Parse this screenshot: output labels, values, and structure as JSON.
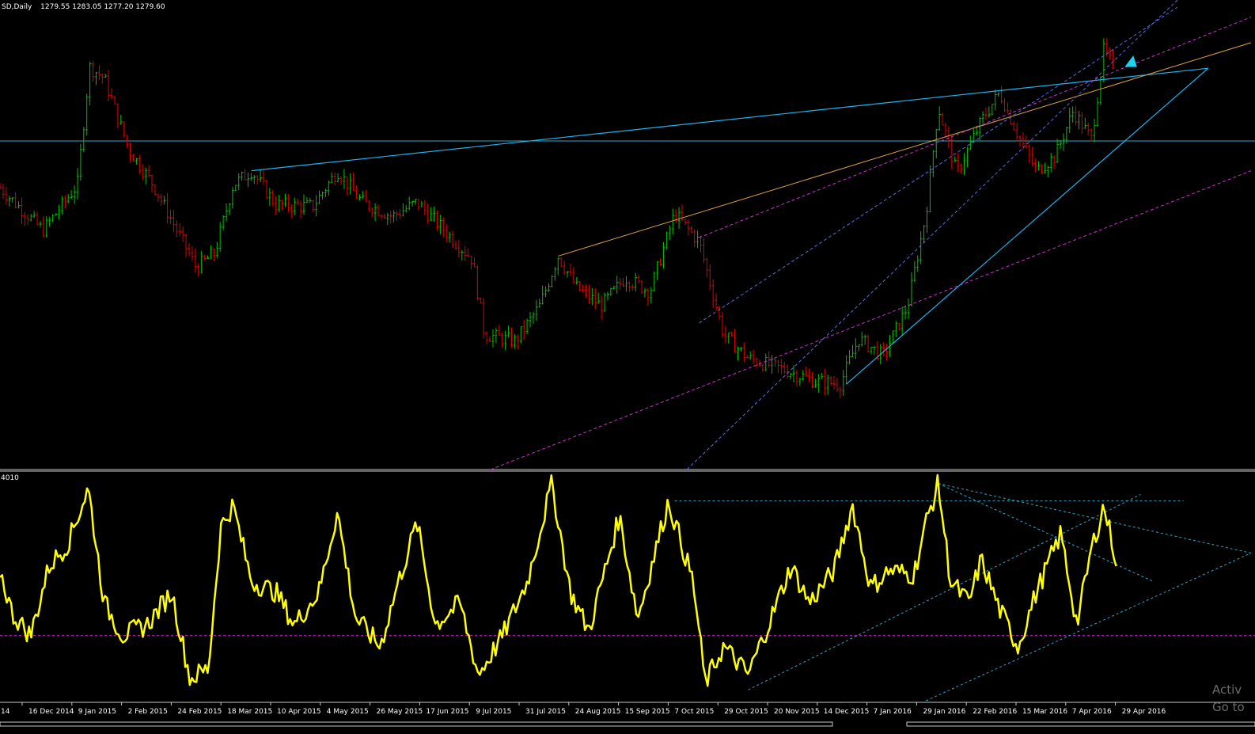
{
  "chart_data": {
    "type": "candlestick-with-oscillator",
    "header": {
      "symbol_timeframe": "SD,Daily",
      "ohlc": "1279.55 1283.05 1277.20 1279.60"
    },
    "oscillator_label": "4010",
    "x_tick_labels": [
      "14",
      "16 Dec 2014",
      "9 Jan 2015",
      "2 Feb 2015",
      "24 Feb 2015",
      "18 Mar 2015",
      "10 Apr 2015",
      "4 May 2015",
      "26 May 2015",
      "17 Jun 2015",
      "9 Jul 2015",
      "31 Jul 2015",
      "24 Aug 2015",
      "15 Sep 2015",
      "7 Oct 2015",
      "29 Oct 2015",
      "20 Nov 2015",
      "14 Dec 2015",
      "7 Jan 2016",
      "29 Jan 2016",
      "22 Feb 2016",
      "15 Mar 2016",
      "7 Apr 2016",
      "29 Apr 2016"
    ],
    "price_anchors": [
      {
        "t": 0,
        "p": 1198
      },
      {
        "t": 0.035,
        "p": 1168
      },
      {
        "t": 0.063,
        "p": 1200
      },
      {
        "t": 0.073,
        "p": 1283
      },
      {
        "t": 0.085,
        "p": 1275
      },
      {
        "t": 0.105,
        "p": 1225
      },
      {
        "t": 0.125,
        "p": 1200
      },
      {
        "t": 0.16,
        "p": 1142
      },
      {
        "t": 0.175,
        "p": 1152
      },
      {
        "t": 0.19,
        "p": 1200
      },
      {
        "t": 0.205,
        "p": 1210
      },
      {
        "t": 0.225,
        "p": 1186
      },
      {
        "t": 0.255,
        "p": 1185
      },
      {
        "t": 0.275,
        "p": 1210
      },
      {
        "t": 0.295,
        "p": 1188
      },
      {
        "t": 0.32,
        "p": 1178
      },
      {
        "t": 0.34,
        "p": 1188
      },
      {
        "t": 0.36,
        "p": 1170
      },
      {
        "t": 0.385,
        "p": 1148
      },
      {
        "t": 0.395,
        "p": 1095
      },
      {
        "t": 0.42,
        "p": 1090
      },
      {
        "t": 0.44,
        "p": 1115
      },
      {
        "t": 0.455,
        "p": 1150
      },
      {
        "t": 0.47,
        "p": 1128
      },
      {
        "t": 0.49,
        "p": 1115
      },
      {
        "t": 0.51,
        "p": 1135
      },
      {
        "t": 0.53,
        "p": 1125
      },
      {
        "t": 0.55,
        "p": 1180
      },
      {
        "t": 0.57,
        "p": 1160
      },
      {
        "t": 0.59,
        "p": 1095
      },
      {
        "t": 0.61,
        "p": 1078
      },
      {
        "t": 0.64,
        "p": 1070
      },
      {
        "t": 0.665,
        "p": 1062
      },
      {
        "t": 0.685,
        "p": 1060
      },
      {
        "t": 0.7,
        "p": 1092
      },
      {
        "t": 0.72,
        "p": 1080
      },
      {
        "t": 0.74,
        "p": 1115
      },
      {
        "t": 0.755,
        "p": 1180
      },
      {
        "t": 0.765,
        "p": 1255
      },
      {
        "t": 0.78,
        "p": 1208
      },
      {
        "t": 0.8,
        "p": 1245
      },
      {
        "t": 0.815,
        "p": 1265
      },
      {
        "t": 0.83,
        "p": 1235
      },
      {
        "t": 0.845,
        "p": 1210
      },
      {
        "t": 0.86,
        "p": 1220
      },
      {
        "t": 0.875,
        "p": 1252
      },
      {
        "t": 0.89,
        "p": 1232
      },
      {
        "t": 0.9,
        "p": 1295
      },
      {
        "t": 0.91,
        "p": 1279
      }
    ],
    "oscillator_anchors": [
      {
        "t": 0,
        "v": 60
      },
      {
        "t": 0.01,
        "v": 40
      },
      {
        "t": 0.025,
        "v": 30
      },
      {
        "t": 0.04,
        "v": 62
      },
      {
        "t": 0.055,
        "v": 72
      },
      {
        "t": 0.072,
        "v": 98
      },
      {
        "t": 0.085,
        "v": 45
      },
      {
        "t": 0.1,
        "v": 30
      },
      {
        "t": 0.12,
        "v": 35
      },
      {
        "t": 0.14,
        "v": 50
      },
      {
        "t": 0.155,
        "v": 10
      },
      {
        "t": 0.17,
        "v": 15
      },
      {
        "t": 0.18,
        "v": 80
      },
      {
        "t": 0.19,
        "v": 90
      },
      {
        "t": 0.205,
        "v": 55
      },
      {
        "t": 0.225,
        "v": 50
      },
      {
        "t": 0.24,
        "v": 35
      },
      {
        "t": 0.26,
        "v": 50
      },
      {
        "t": 0.275,
        "v": 87
      },
      {
        "t": 0.29,
        "v": 38
      },
      {
        "t": 0.31,
        "v": 25
      },
      {
        "t": 0.325,
        "v": 55
      },
      {
        "t": 0.34,
        "v": 82
      },
      {
        "t": 0.355,
        "v": 35
      },
      {
        "t": 0.375,
        "v": 45
      },
      {
        "t": 0.39,
        "v": 12
      },
      {
        "t": 0.41,
        "v": 30
      },
      {
        "t": 0.43,
        "v": 55
      },
      {
        "t": 0.45,
        "v": 100
      },
      {
        "t": 0.465,
        "v": 50
      },
      {
        "t": 0.48,
        "v": 32
      },
      {
        "t": 0.505,
        "v": 85
      },
      {
        "t": 0.52,
        "v": 38
      },
      {
        "t": 0.545,
        "v": 92
      },
      {
        "t": 0.565,
        "v": 55
      },
      {
        "t": 0.575,
        "v": 8
      },
      {
        "t": 0.59,
        "v": 25
      },
      {
        "t": 0.61,
        "v": 12
      },
      {
        "t": 0.63,
        "v": 40
      },
      {
        "t": 0.645,
        "v": 62
      },
      {
        "t": 0.66,
        "v": 45
      },
      {
        "t": 0.68,
        "v": 60
      },
      {
        "t": 0.695,
        "v": 90
      },
      {
        "t": 0.71,
        "v": 52
      },
      {
        "t": 0.725,
        "v": 60
      },
      {
        "t": 0.745,
        "v": 58
      },
      {
        "t": 0.755,
        "v": 82
      },
      {
        "t": 0.765,
        "v": 100
      },
      {
        "t": 0.775,
        "v": 55
      },
      {
        "t": 0.79,
        "v": 45
      },
      {
        "t": 0.8,
        "v": 65
      },
      {
        "t": 0.815,
        "v": 42
      },
      {
        "t": 0.83,
        "v": 25
      },
      {
        "t": 0.845,
        "v": 50
      },
      {
        "t": 0.865,
        "v": 77
      },
      {
        "t": 0.878,
        "v": 35
      },
      {
        "t": 0.89,
        "v": 70
      },
      {
        "t": 0.9,
        "v": 90
      },
      {
        "t": 0.91,
        "v": 65
      }
    ],
    "price_ylim": [
      1000,
      1330
    ],
    "oscillator_ylim": [
      0,
      105
    ],
    "oscillator_reference_level": 30,
    "colors": {
      "background": "#000000",
      "bull": "#00c000",
      "bear": "#e00000",
      "oscillator": "#ffff00",
      "trend_cyan": "#19b4f0",
      "trend_orange": "#e0a040",
      "trend_magenta": "#d030d0",
      "trend_blue_dashed": "#5a6fe0",
      "level_line": "#2ea8c8",
      "text": "#ffffff"
    },
    "watermark": "Activ\nGo to"
  }
}
